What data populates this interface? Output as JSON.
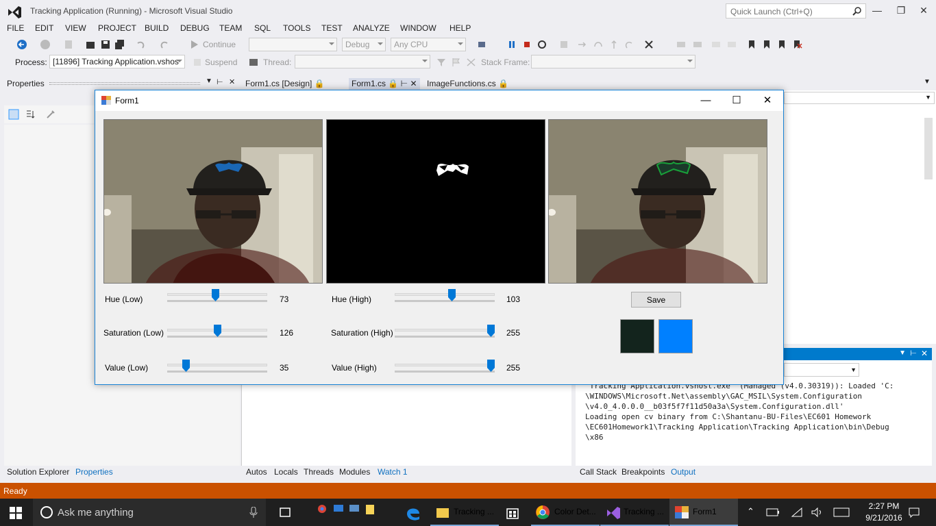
{
  "window": {
    "title": "Tracking Application (Running) - Microsoft Visual Studio"
  },
  "quick_launch": {
    "placeholder": "Quick Launch (Ctrl+Q)"
  },
  "menu": [
    "FILE",
    "EDIT",
    "VIEW",
    "PROJECT",
    "BUILD",
    "DEBUG",
    "TEAM",
    "SQL",
    "TOOLS",
    "TEST",
    "ANALYZE",
    "WINDOW",
    "HELP"
  ],
  "toolbar": {
    "continue": "Continue",
    "config": "Debug",
    "platform": "Any CPU",
    "process_label": "Process:",
    "process_value": "[11896] Tracking Application.vshos",
    "suspend": "Suspend",
    "thread_label": "Thread:",
    "stack_frame_label": "Stack Frame:"
  },
  "properties_panel": {
    "title": "Properties"
  },
  "doc_tabs": [
    "Form1.cs [Design]",
    "Form1.cs",
    "ImageFunctions.cs"
  ],
  "output": {
    "lines": [
      "'Tracking Application.vshost.exe' (Managed (v4.0.30319)): Loaded 'C:",
      "\\WINDOWS\\Microsoft.Net\\assembly\\GAC_MSIL\\System.Configuration",
      "\\v4.0_4.0.0.0__b03f5f7f11d50a3a\\System.Configuration.dll'",
      "Loading open cv binary from C:\\Shantanu-BU-Files\\EC601 Homework",
      "\\EC601Homework1\\Tracking Application\\Tracking Application\\bin\\Debug",
      "\\x86"
    ]
  },
  "bottom_tabs_left": [
    "Solution Explorer",
    "Properties"
  ],
  "bottom_tabs_mid": [
    "Autos",
    "Locals",
    "Threads",
    "Modules",
    "Watch 1"
  ],
  "bottom_tabs_right": [
    "Call Stack",
    "Breakpoints",
    "Output"
  ],
  "status": {
    "text": "Ready"
  },
  "form1": {
    "title": "Form1",
    "sliders": {
      "hue_low": {
        "label": "Hue (Low)",
        "value": "73",
        "fraction": 0.474
      },
      "hue_high": {
        "label": "Hue (High)",
        "value": "103",
        "fraction": 0.576
      },
      "sat_low": {
        "label": "Saturation (Low)",
        "value": "126",
        "fraction": 0.5
      },
      "sat_high": {
        "label": "Saturation (High)",
        "value": "255",
        "fraction": 1.0
      },
      "val_low": {
        "label": "Value (Low)",
        "value": "35",
        "fraction": 0.16
      },
      "val_high": {
        "label": "Value (High)",
        "value": "255",
        "fraction": 1.0
      }
    },
    "save_label": "Save",
    "swatches": {
      "low": "#13241d",
      "high": "#0080ff"
    }
  },
  "taskbar": {
    "search_placeholder": "Ask me anything",
    "tasks": [
      "Tracking ...",
      "Color Det...",
      "Tracking ...",
      "Form1"
    ],
    "time": "2:27 PM",
    "date": "9/21/2016"
  },
  "colors": {
    "accent": "#007acc",
    "status_bar": "#ca5100",
    "slider_thumb": "#0078d7"
  }
}
